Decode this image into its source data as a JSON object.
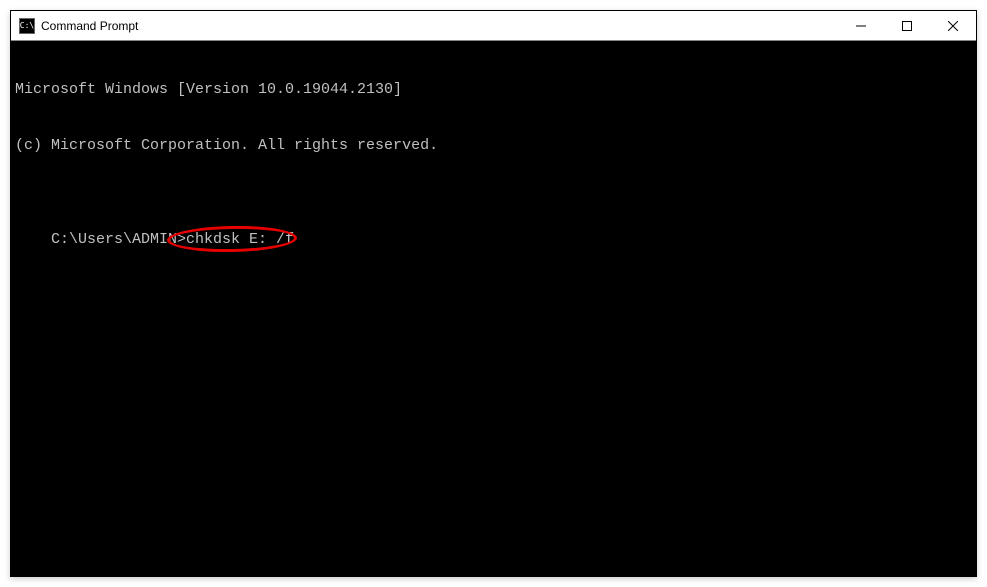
{
  "window": {
    "title": "Command Prompt",
    "icon_glyph": "C:\\"
  },
  "terminal": {
    "header_line1": "Microsoft Windows [Version 10.0.19044.2130]",
    "header_line2": "(c) Microsoft Corporation. All rights reserved.",
    "prompt": "C:\\Users\\ADMIN>",
    "command": "chkdsk E: /f"
  },
  "annotation": {
    "highlight_color": "#e60000"
  }
}
